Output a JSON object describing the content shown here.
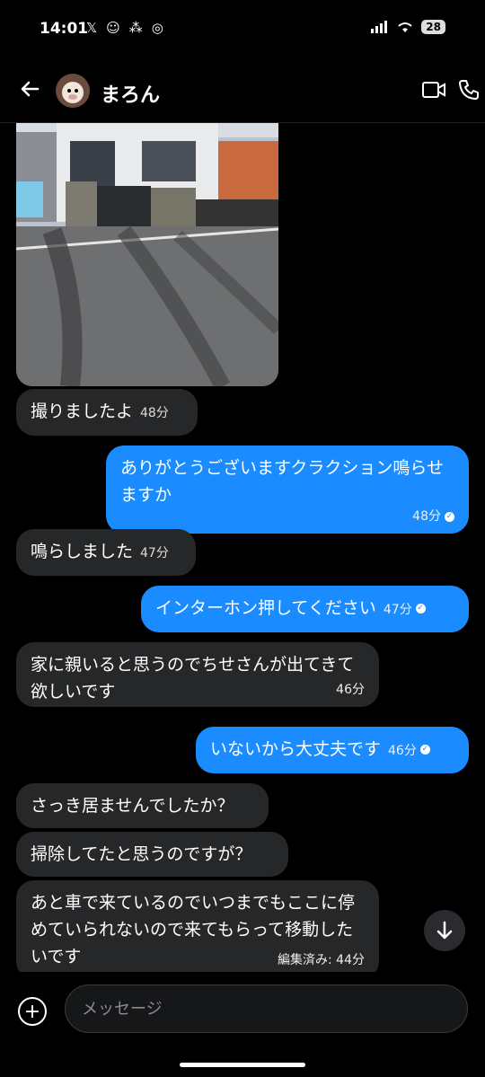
{
  "status_bar": {
    "time": "14:01",
    "battery": "28"
  },
  "header": {
    "contact_name": "まろん"
  },
  "messages": [
    {
      "text": "撮りましたよ",
      "time": "48分"
    },
    {
      "text": "ありがとうございますクラクション鳴らせますか",
      "time": "48分"
    },
    {
      "text": "鳴らしました",
      "time": "47分"
    },
    {
      "text": "インターホン押してください",
      "time": "47分"
    },
    {
      "text": "家に親いると思うのでちせさんが出てきて欲しいです",
      "time": "46分"
    },
    {
      "text": "いないから大丈夫です",
      "time": "46分"
    },
    {
      "text": "さっき居ませんでしたか？"
    },
    {
      "text": "掃除してたと思うのですが？"
    },
    {
      "text": "あと車で来ているのでいつまでもここに停めていられないので来てもらって移動したいです",
      "time": "編集済み: 44分"
    }
  ],
  "composer": {
    "placeholder": "メッセージ"
  },
  "colors": {
    "outgoing_bubble": "#1a8cff",
    "incoming_bubble": "#262729",
    "background": "#000000"
  },
  "icons": [
    "x-icon",
    "bot-icon",
    "app-icon",
    "wifi-icon",
    "signal-icon",
    "back-arrow-icon",
    "video-call-icon",
    "phone-icon",
    "arrow-down-icon",
    "plus-icon"
  ]
}
